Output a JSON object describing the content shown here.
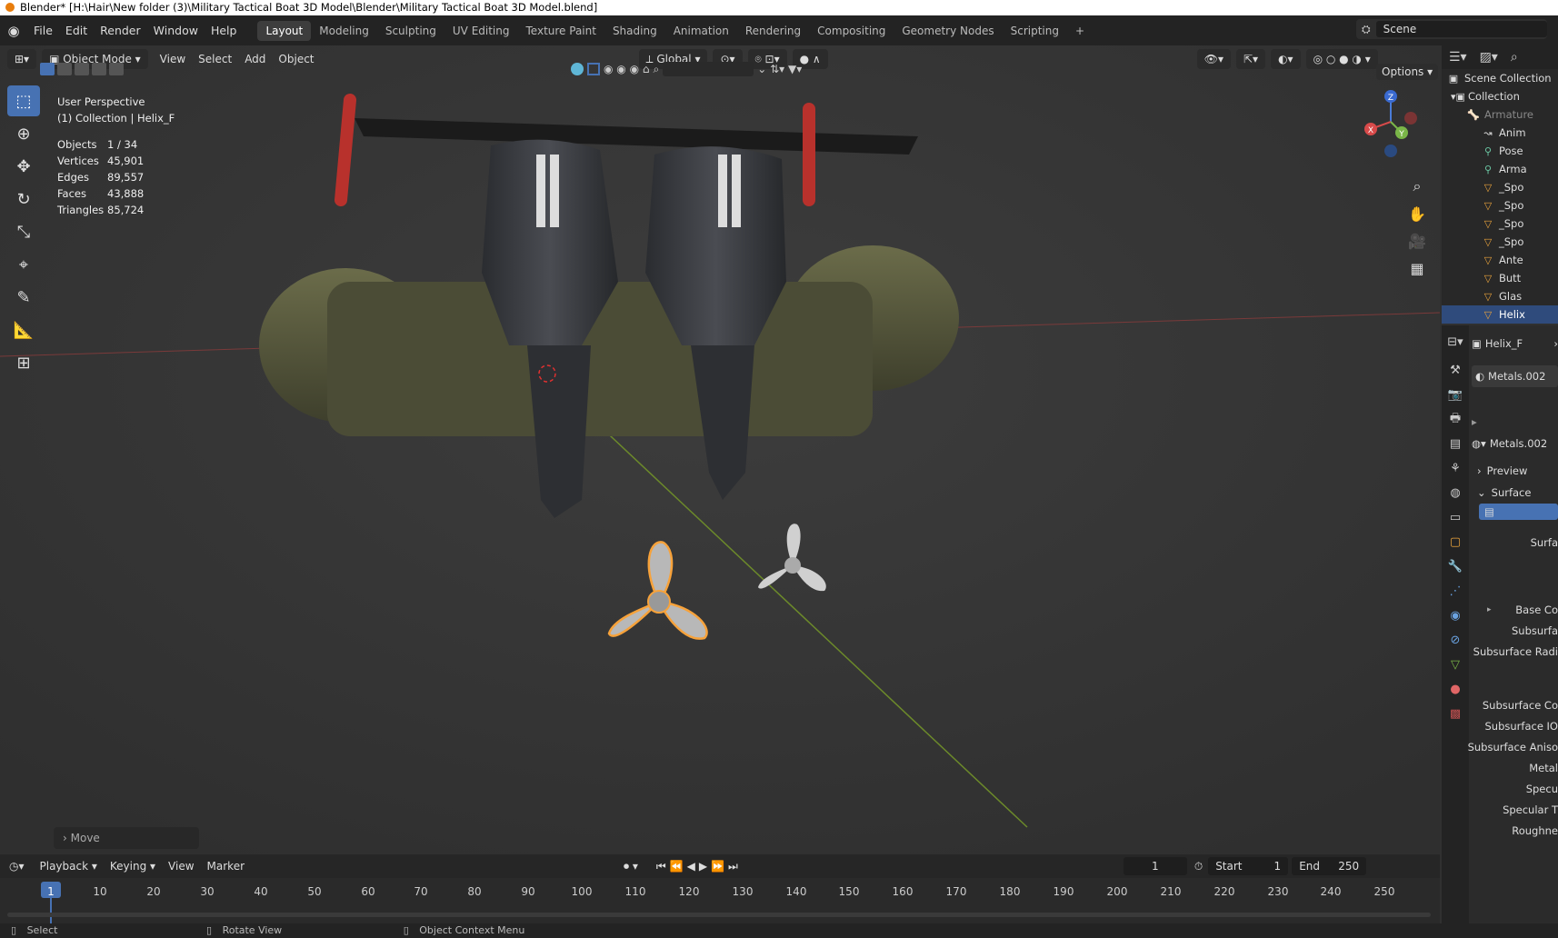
{
  "window": {
    "title": "Blender* [H:\\Hair\\New folder (3)\\Military Tactical Boat 3D Model\\Blender\\Military Tactical Boat 3D Model.blend]"
  },
  "menus": [
    "File",
    "Edit",
    "Render",
    "Window",
    "Help"
  ],
  "workspaces": [
    "Layout",
    "Modeling",
    "Sculpting",
    "UV Editing",
    "Texture Paint",
    "Shading",
    "Animation",
    "Rendering",
    "Compositing",
    "Geometry Nodes",
    "Scripting"
  ],
  "scene": {
    "name": "Scene"
  },
  "viewport": {
    "mode": "Object Mode",
    "menus": [
      "View",
      "Select",
      "Add",
      "Object"
    ],
    "orientation": "Global",
    "options_label": "Options",
    "perspective": "User Perspective",
    "collection_info": "(1) Collection | Helix_F",
    "stats": [
      {
        "label": "Objects",
        "value": "1 / 34"
      },
      {
        "label": "Vertices",
        "value": "45,901"
      },
      {
        "label": "Edges",
        "value": "89,557"
      },
      {
        "label": "Faces",
        "value": "43,888"
      },
      {
        "label": "Triangles",
        "value": "85,724"
      }
    ],
    "last_op": "Move",
    "gizmo": {
      "x": "X",
      "y": "Y",
      "z": "Z"
    }
  },
  "outliner": {
    "items": [
      {
        "label": "Scene Collection",
        "indent": 0
      },
      {
        "label": "Collection",
        "indent": 1
      },
      {
        "label": "Armature",
        "indent": 2
      },
      {
        "label": "Anim",
        "indent": 3
      },
      {
        "label": "Pose",
        "indent": 3
      },
      {
        "label": "Arma",
        "indent": 3
      },
      {
        "label": "_Spo",
        "indent": 3
      },
      {
        "label": "_Spo",
        "indent": 3
      },
      {
        "label": "_Spo",
        "indent": 3
      },
      {
        "label": "_Spo",
        "indent": 3
      },
      {
        "label": "Ante",
        "indent": 3
      },
      {
        "label": "Butt",
        "indent": 3
      },
      {
        "label": "Glas",
        "indent": 3
      },
      {
        "label": "Helix",
        "indent": 3
      }
    ]
  },
  "properties": {
    "object_name": "Helix_F",
    "material": "Metals.002",
    "material_field": "Metals.002",
    "preview_label": "Preview",
    "surface_label": "Surface",
    "fields": [
      "Surfa",
      "Base Co",
      "Subsurfa",
      "Subsurface Radi",
      "Subsurface Co",
      "Subsurface IO",
      "Subsurface Aniso",
      "Metal",
      "Specu",
      "Specular T",
      "Roughne"
    ]
  },
  "timeline": {
    "menus": [
      "Playback",
      "Keying",
      "View",
      "Marker"
    ],
    "current_frame": "1",
    "start_label": "Start",
    "start": "1",
    "end_label": "End",
    "end": "250",
    "ruler": [
      "1",
      "10",
      "20",
      "30",
      "40",
      "50",
      "60",
      "70",
      "80",
      "90",
      "100",
      "110",
      "120",
      "130",
      "140",
      "150",
      "160",
      "170",
      "180",
      "190",
      "200",
      "210",
      "220",
      "230",
      "240",
      "250"
    ]
  },
  "statusbar": {
    "items": [
      "Select",
      "Rotate View",
      "Object Context Menu"
    ]
  }
}
